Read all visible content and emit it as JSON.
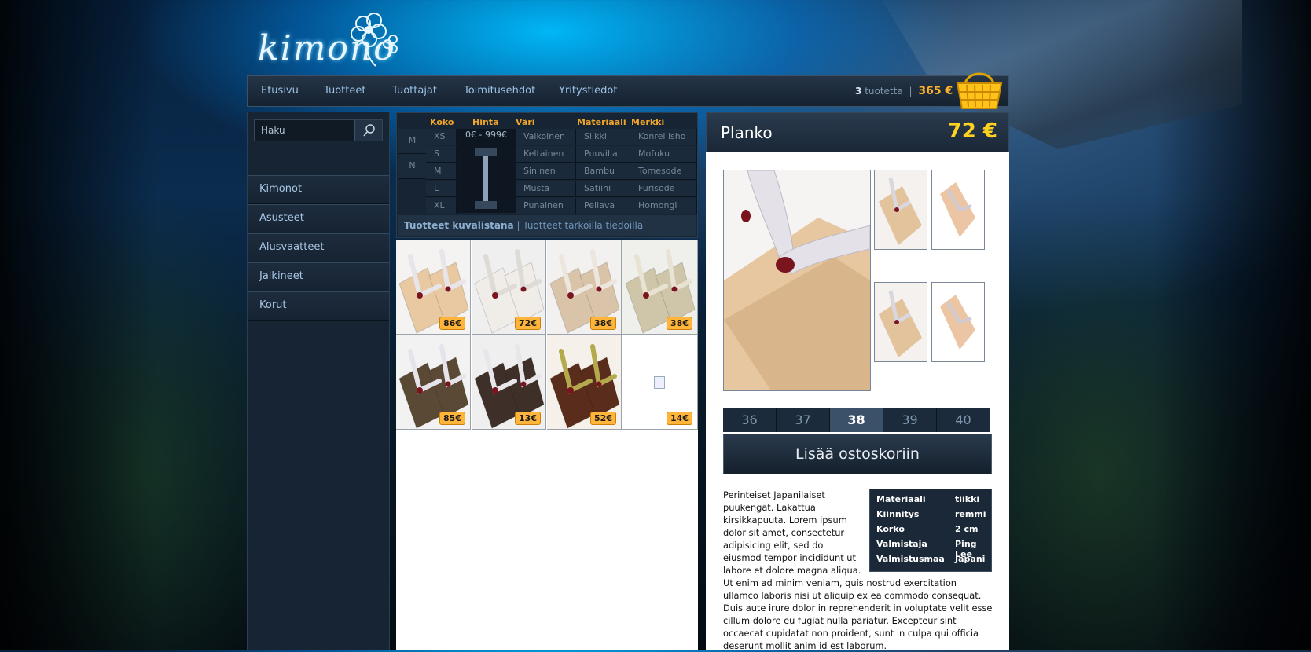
{
  "logo": {
    "text": "kimono"
  },
  "topnav": {
    "items": [
      "Etusivu",
      "Tuotteet",
      "Tuottajat",
      "Toimitusehdot",
      "Yritystiedot"
    ]
  },
  "cart": {
    "count": "3",
    "count_label": "tuotetta",
    "separator": "|",
    "total": "365 €"
  },
  "search": {
    "placeholder": "Haku"
  },
  "categories": [
    "Kimonot",
    "Asusteet",
    "Alusvaatteet",
    "Jalkineet",
    "Korut"
  ],
  "filters": {
    "headers": {
      "size": "Koko",
      "price": "Hinta",
      "color": "Väri",
      "material": "Materiaali",
      "brand": "Merkki"
    },
    "genders": [
      "M",
      "N"
    ],
    "sizes": [
      "XS",
      "S",
      "M",
      "L",
      "XL"
    ],
    "price_range": "0€ - 999€",
    "colors": [
      "Valkoinen",
      "Keltainen",
      "Sininen",
      "Musta",
      "Punainen"
    ],
    "materials": [
      "Silkki",
      "Puuvilla",
      "Bambu",
      "Satiini",
      "Pellava"
    ],
    "brands": [
      "Konrei isho",
      "Mofuku",
      "Tomesode",
      "Furisode",
      "Homongi"
    ]
  },
  "view_tabs": {
    "active": "Tuotteet kuvalistana",
    "separator": "|",
    "other": "Tuotteet tarkoilla tiedoilla"
  },
  "products": [
    {
      "price": "86€",
      "sole": "#e8c9a2",
      "strap": "#e7e4ea",
      "bg": "#f4f3f1"
    },
    {
      "price": "72€",
      "sole": "#f0ede8",
      "strap": "#dedad5",
      "bg": "#efefef"
    },
    {
      "price": "38€",
      "sole": "#d9c4aa",
      "strap": "#ece6de",
      "bg": "#f2f1ef"
    },
    {
      "price": "38€",
      "sole": "#cfc5a9",
      "strap": "#e7e2d2",
      "bg": "#efefec"
    },
    {
      "price": "85€",
      "sole": "#5a4a35",
      "strap": "#e6e3ea",
      "bg": "#f2f2f2"
    },
    {
      "price": "13€",
      "sole": "#3e3028",
      "strap": "#e8e6ea",
      "bg": "#efefef"
    },
    {
      "price": "52€",
      "sole": "#5a2c1c",
      "strap": "#b4a94c",
      "bg": "#f5f1ea"
    },
    {
      "price": "14€",
      "sole": "",
      "strap": "",
      "bg": "#ffffff"
    }
  ],
  "product": {
    "name": "Planko",
    "price": "72 €",
    "sizes": [
      "36",
      "37",
      "38",
      "39",
      "40"
    ],
    "selected_size": "38",
    "add_to_cart": "Lisää ostoskoriin",
    "description": "Perinteiset Japanilaiset puukengät. Lakattua kirsikkapuuta. Lorem ipsum dolor sit amet, consectetur adipisicing elit, sed do eiusmod tempor incididunt ut labore et dolore magna aliqua. Ut enim ad minim veniam, quis nostrud exercitation ullamco laboris nisi ut aliquip ex ea commodo consequat. Duis aute irure dolor in reprehenderit in voluptate velit esse cillum dolore eu fugiat nulla pariatur. Excepteur sint occaecat cupidatat non proident, sunt in culpa qui officia deserunt mollit anim id est laborum.",
    "specs": [
      {
        "key": "Materiaali",
        "value": "tiikki"
      },
      {
        "key": "Kiinnitys",
        "value": "remmi"
      },
      {
        "key": "Korko",
        "value": "2 cm"
      },
      {
        "key": "Valmistaja",
        "value": "Ping Lee"
      },
      {
        "key": "Valmistusmaa",
        "value": "Japani"
      }
    ]
  },
  "colors": {
    "accent": "#ffb12a",
    "price_yellow": "#ffd21f",
    "nav_text": "#9cc3e6",
    "panel": "#172434"
  }
}
